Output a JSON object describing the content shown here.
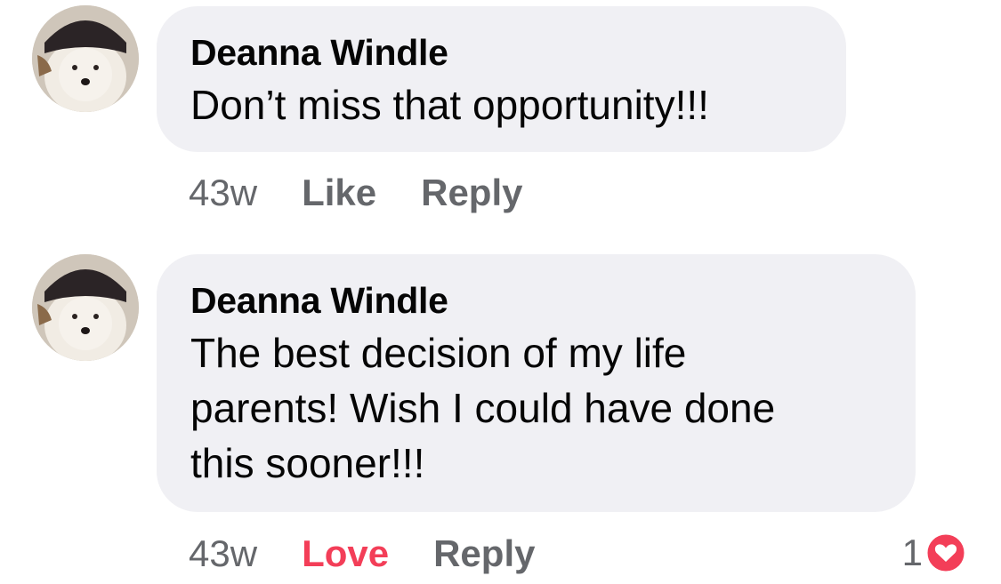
{
  "comments": [
    {
      "author": "Deanna Windle",
      "text": "Don’t miss that opportunity!!!",
      "time": "43w",
      "like_label": "Like",
      "reply_label": "Reply"
    },
    {
      "author": "Deanna Windle",
      "text": "The best decision of my life\nparents!  Wish I could have done\nthis sooner!!!",
      "time": "43w",
      "like_label": "Love",
      "reply_label": "Reply",
      "reaction_count": "1",
      "reaction_icon": "heart-icon"
    }
  ],
  "colors": {
    "bubble": "#f0f0f4",
    "secondary_text": "#65676b",
    "love": "#f33e58"
  }
}
